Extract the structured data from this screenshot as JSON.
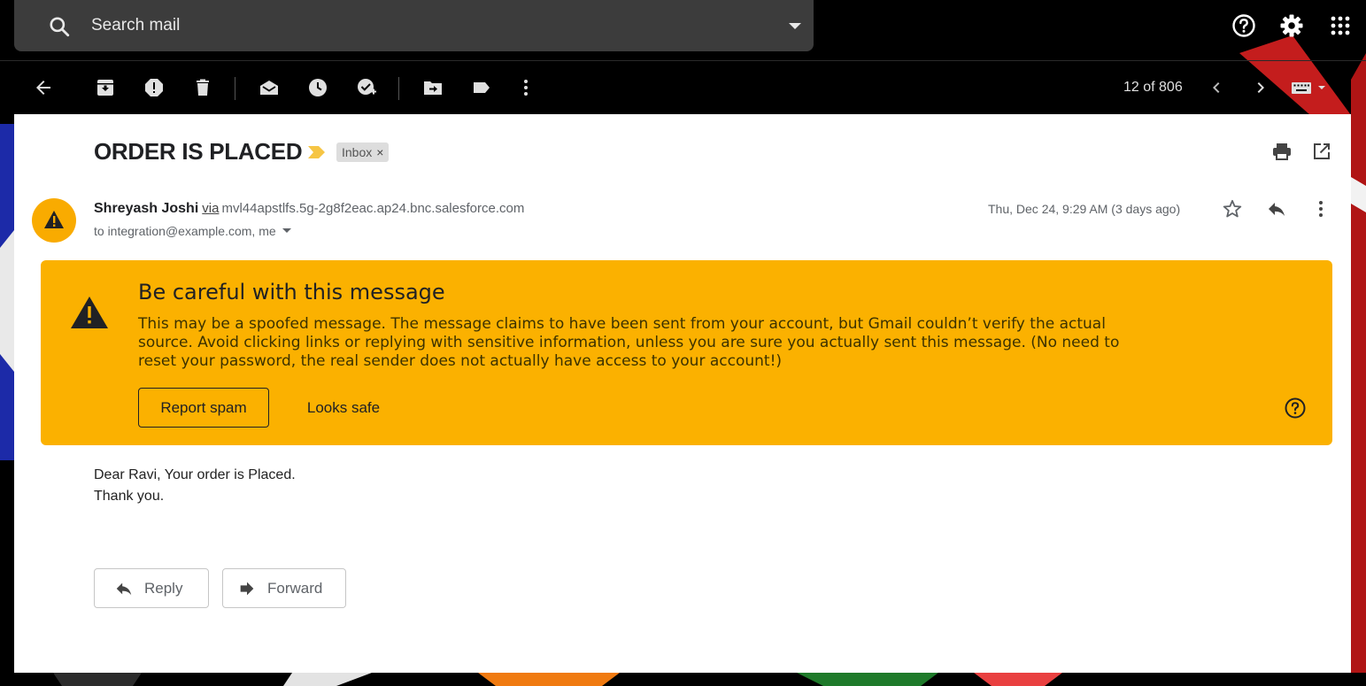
{
  "search": {
    "placeholder": "Search mail"
  },
  "topbar_icons": [
    "help-icon",
    "settings-icon",
    "apps-icon"
  ],
  "toolbar": {
    "icons": [
      "back-icon",
      "archive-icon",
      "report-spam-icon",
      "delete-icon",
      "mark-unread-icon",
      "snooze-icon",
      "add-task-icon",
      "move-to-icon",
      "labels-icon",
      "more-icon"
    ],
    "pagination": "12 of 806"
  },
  "message": {
    "subject": "ORDER IS PLACED",
    "label": "Inbox",
    "label_remove": "×",
    "sender_name": "Shreyash Joshi",
    "via": "via",
    "sender_domain": "mvl44apstlfs.5g-2g8f2eac.ap24.bnc.salesforce.com",
    "to": "to integration@example.com, me",
    "date": "Thu, Dec 24, 9:29 AM (3 days ago)",
    "body_line_1": "Dear Ravi, Your order is Placed.",
    "body_line_2": "Thank you."
  },
  "warning": {
    "title": "Be careful with this message",
    "body": "This may be a spoofed message. The message claims to have been sent from your account, but Gmail couldn’t verify the actual source. Avoid clicking links or replying with sensitive information, unless you are sure you actually sent this message. (No need to reset your password, the real sender does not actually have access to your account!)",
    "report_spam": "Report spam",
    "looks_safe": "Looks safe"
  },
  "actions": {
    "reply": "Reply",
    "forward": "Forward"
  },
  "colors": {
    "warning_bg": "#fbb100",
    "avatar_bg": "#f9ab00",
    "importance_marker": "#f6c544"
  }
}
